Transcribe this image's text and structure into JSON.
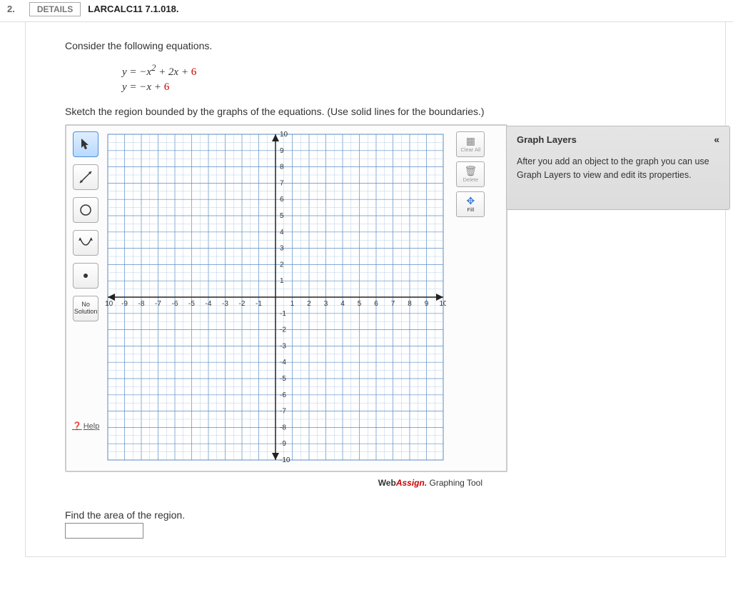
{
  "header": {
    "question_number": "2.",
    "details_label": "DETAILS",
    "reference": "LARCALC11 7.1.018."
  },
  "prompt": "Consider the following equations.",
  "equations": {
    "eq1_lhs": "y = −x",
    "eq1_exp": "2",
    "eq1_mid": " + 2x + ",
    "eq1_const": "6",
    "eq2_lhs": "y = −x + ",
    "eq2_const": "6"
  },
  "sketch_instruction": "Sketch the region bounded by the graphs of the equations. (Use solid lines for the boundaries.)",
  "tools": {
    "pointer": "pointer",
    "line": "line",
    "parabola": "parabola",
    "open_parabola": "open-parabola",
    "point": "point",
    "no_solution": "No\nSolution",
    "help": "Help"
  },
  "side_tools": {
    "clear_all": "Clear All",
    "delete": "Delete",
    "fill": "Fill"
  },
  "layers_panel": {
    "title": "Graph Layers",
    "collapse": "«",
    "body": "After you add an object to the graph you can use Graph Layers to view and edit its properties."
  },
  "branding": {
    "web": "Web",
    "assign": "Assign.",
    "suffix": " Graphing Tool"
  },
  "find_area": "Find the area of the region.",
  "chart_data": {
    "type": "scatter",
    "title": "",
    "xlabel": "",
    "ylabel": "",
    "xlim": [
      -10,
      10
    ],
    "ylim": [
      -10,
      10
    ],
    "xticks": [
      -10,
      -9,
      -8,
      -7,
      -6,
      -5,
      -4,
      -3,
      -2,
      -1,
      1,
      2,
      3,
      4,
      5,
      6,
      7,
      8,
      9,
      10
    ],
    "yticks": [
      -10,
      -9,
      -8,
      -7,
      -6,
      -5,
      -4,
      -3,
      -2,
      -1,
      1,
      2,
      3,
      4,
      5,
      6,
      7,
      8,
      9,
      10
    ],
    "series": []
  }
}
